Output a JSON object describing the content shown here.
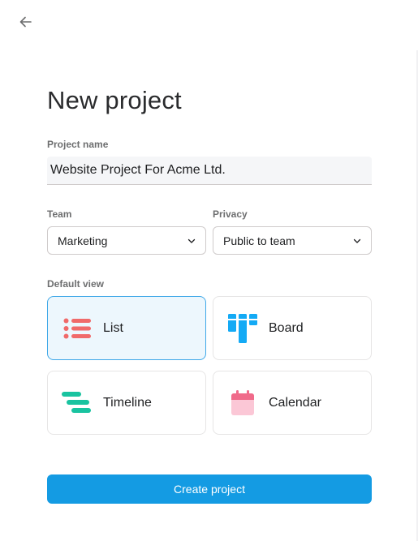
{
  "header": {
    "back_icon": "arrow-left-icon"
  },
  "form": {
    "title": "New project",
    "project_name_label": "Project name",
    "project_name_value": "Website Project For Acme Ltd.",
    "team_label": "Team",
    "team_value": "Marketing",
    "privacy_label": "Privacy",
    "privacy_value": "Public to team",
    "default_view_label": "Default view",
    "views": [
      {
        "label": "List",
        "icon": "list-icon",
        "selected": true
      },
      {
        "label": "Board",
        "icon": "board-icon",
        "selected": false
      },
      {
        "label": "Timeline",
        "icon": "timeline-icon",
        "selected": false
      },
      {
        "label": "Calendar",
        "icon": "calendar-icon",
        "selected": false
      }
    ],
    "submit_label": "Create project"
  },
  "colors": {
    "accent": "#149be3",
    "list_icon": "#f06a6a",
    "board_icon": "#14aaf5",
    "timeline_icon": "#19c3a0",
    "calendar_icon": "#f9aaef",
    "selected_bg": "#edf7fd",
    "selected_border": "#3fa8e8"
  }
}
